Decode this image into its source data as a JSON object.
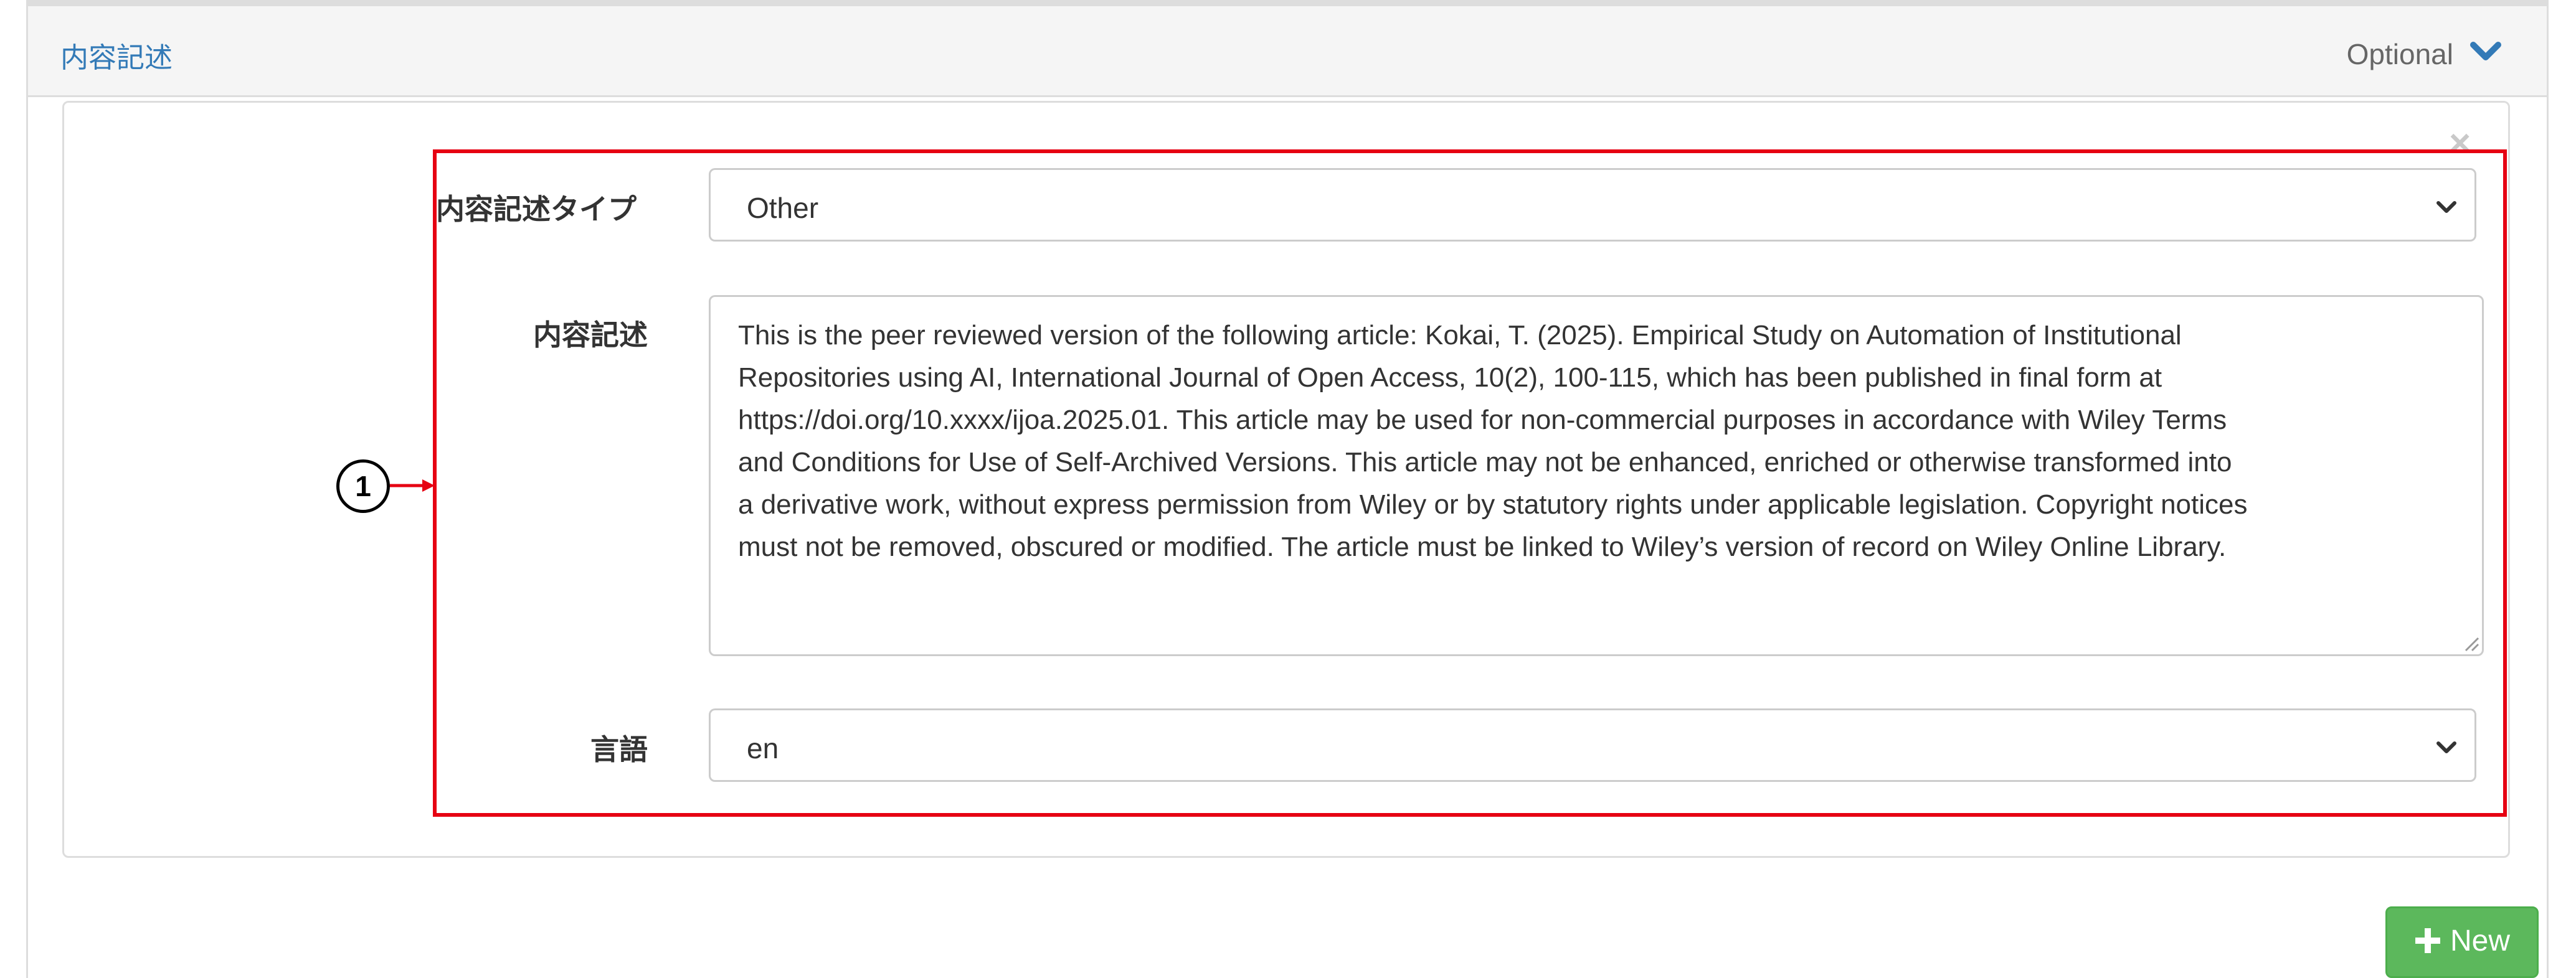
{
  "panel": {
    "title": "内容記述",
    "optional_label": "Optional",
    "chevron_icon": "chevron-down-icon"
  },
  "form": {
    "description_type": {
      "label": "内容記述タイプ",
      "value": "Other"
    },
    "description": {
      "label": "内容記述",
      "value": "This is the peer reviewed version of the following article: Kokai, T. (2025). Empirical Study on Automation of Institutional\nRepositories using AI, International Journal of Open Access, 10(2), 100-115, which has been published in final form at\nhttps://doi.org/10.xxxx/ijoa.2025.01. This article may be used for non-commercial purposes in accordance with Wiley Terms\nand Conditions for Use of Self-Archived Versions. This article may not be enhanced, enriched or otherwise transformed into\na derivative work, without express permission from Wiley or by statutory rights under applicable legislation. Copyright notices\nmust not be removed, obscured or modified. The article must be linked to Wiley’s version of record on Wiley Online Library."
    },
    "language": {
      "label": "言語",
      "value": "en"
    },
    "remove_icon": "close-icon"
  },
  "annotation": {
    "callout_number": "1",
    "highlight_color": "#e60012"
  },
  "actions": {
    "new_label": "New",
    "new_icon": "plus-icon"
  },
  "colors": {
    "title_link": "#337ab7",
    "new_button": "#5cb85c"
  }
}
